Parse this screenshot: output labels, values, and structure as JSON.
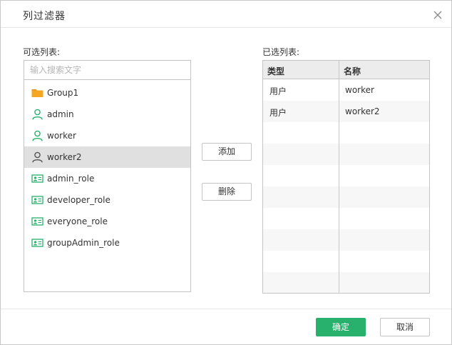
{
  "dialog": {
    "title": "列过滤器",
    "close_icon": "close-icon"
  },
  "available": {
    "label": "可选列表:",
    "search_placeholder": "输入搜索文字",
    "items": [
      {
        "label": "Group1",
        "icon": "folder-icon",
        "selected": false
      },
      {
        "label": "admin",
        "icon": "user-icon",
        "selected": false
      },
      {
        "label": "worker",
        "icon": "user-icon",
        "selected": false
      },
      {
        "label": "worker2",
        "icon": "user-icon",
        "selected": true
      },
      {
        "label": "admin_role",
        "icon": "role-card-icon",
        "selected": false
      },
      {
        "label": "developer_role",
        "icon": "role-card-icon",
        "selected": false
      },
      {
        "label": "everyone_role",
        "icon": "role-card-icon",
        "selected": false
      },
      {
        "label": "groupAdmin_role",
        "icon": "role-card-icon",
        "selected": false
      }
    ]
  },
  "actions": {
    "add_label": "添加",
    "remove_label": "删除"
  },
  "selected": {
    "label": "已选列表:",
    "columns": [
      "类型",
      "名称"
    ],
    "rows": [
      [
        "用户",
        "worker"
      ],
      [
        "用户",
        "worker2"
      ]
    ]
  },
  "footer": {
    "ok_label": "确定",
    "cancel_label": "取消"
  },
  "colors": {
    "accent_green": "#27b16c",
    "folder_orange": "#f5a623",
    "selected_row": "#e0e0e0"
  }
}
